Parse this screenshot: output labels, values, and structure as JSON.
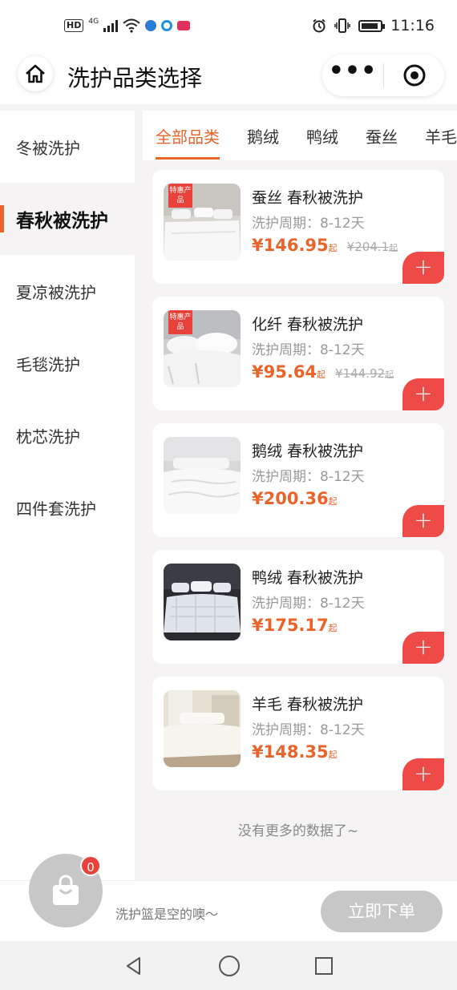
{
  "status_bar": {
    "network_chip": "HD",
    "network_type": "4G",
    "time": "11:16"
  },
  "header": {
    "title": "洗护品类选择",
    "more_label": "•••"
  },
  "sidebar": {
    "items": [
      {
        "label": "冬被洗护"
      },
      {
        "label": "春秋被洗护",
        "active": true
      },
      {
        "label": "夏凉被洗护"
      },
      {
        "label": "毛毯洗护"
      },
      {
        "label": "枕芯洗护"
      },
      {
        "label": "四件套洗护"
      }
    ]
  },
  "tabs": [
    {
      "label": "全部品类",
      "active": true
    },
    {
      "label": "鹅绒"
    },
    {
      "label": "鸭绒"
    },
    {
      "label": "蚕丝"
    },
    {
      "label": "羊毛"
    }
  ],
  "products": [
    {
      "name": "蚕丝 春秋被洗护",
      "cycle": "洗护周期：8-12天",
      "price": "¥146.95",
      "price_suffix": "起",
      "original_price": "¥204.1",
      "original_suffix": "起",
      "badge": "特惠产品"
    },
    {
      "name": "化纤 春秋被洗护",
      "cycle": "洗护周期：8-12天",
      "price": "¥95.64",
      "price_suffix": "起",
      "original_price": "¥144.92",
      "original_suffix": "起",
      "badge": "特惠产品"
    },
    {
      "name": "鹅绒 春秋被洗护",
      "cycle": "洗护周期：8-12天",
      "price": "¥200.36",
      "price_suffix": "起"
    },
    {
      "name": "鸭绒 春秋被洗护",
      "cycle": "洗护周期：8-12天",
      "price": "¥175.17",
      "price_suffix": "起"
    },
    {
      "name": "羊毛 春秋被洗护",
      "cycle": "洗护周期：8-12天",
      "price": "¥148.35",
      "price_suffix": "起"
    }
  ],
  "add_label": "+",
  "no_more_text": "没有更多的数据了~",
  "cart": {
    "count": "0",
    "empty_text": "洗护篮是空的噢～",
    "order_button": "立即下单"
  },
  "colors": {
    "accent": "#e8642a",
    "add_button": "#ee4a48",
    "disabled": "#c7c7c7"
  }
}
